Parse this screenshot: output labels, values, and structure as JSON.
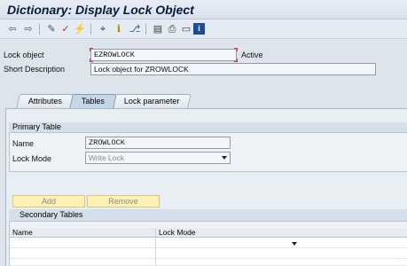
{
  "title": "Dictionary: Display Lock Object",
  "toolbar": {
    "buttons": [
      {
        "name": "back-icon",
        "glyph": "⇦"
      },
      {
        "name": "forward-icon",
        "glyph": "⇨"
      },
      {
        "name": "display-change-icon",
        "glyph": "✎"
      },
      {
        "name": "check-icon",
        "glyph": "✓"
      },
      {
        "name": "activate-icon",
        "glyph": "⚡"
      },
      {
        "name": "where-used-icon",
        "glyph": "⌖"
      },
      {
        "name": "info-icon",
        "glyph": "ℹ"
      },
      {
        "name": "hierarchy-icon",
        "glyph": "⎇"
      },
      {
        "name": "layout-icon",
        "glyph": "▤"
      },
      {
        "name": "print-icon",
        "glyph": "⎙"
      },
      {
        "name": "window-icon",
        "glyph": "▭"
      },
      {
        "name": "help-icon",
        "glyph": "i"
      }
    ]
  },
  "header": {
    "lock_object_label": "Lock object",
    "lock_object_value": "EZROWLOCK",
    "status": "Active",
    "short_desc_label": "Short Description",
    "short_desc_value": "Lock object for ZROWLOCK"
  },
  "tabs": [
    {
      "label": "Attributes",
      "active": false
    },
    {
      "label": "Tables",
      "active": true
    },
    {
      "label": "Lock parameter",
      "active": false
    }
  ],
  "primary_table": {
    "group_title": "Primary Table",
    "name_label": "Name",
    "name_value": "ZROWLOCK",
    "lock_mode_label": "Lock Mode",
    "lock_mode_value": "Write Lock"
  },
  "buttons": {
    "add": "Add",
    "remove": "Remove"
  },
  "secondary_tables": {
    "title": "Secondary Tables",
    "columns": [
      "Name",
      "Lock Mode"
    ]
  }
}
